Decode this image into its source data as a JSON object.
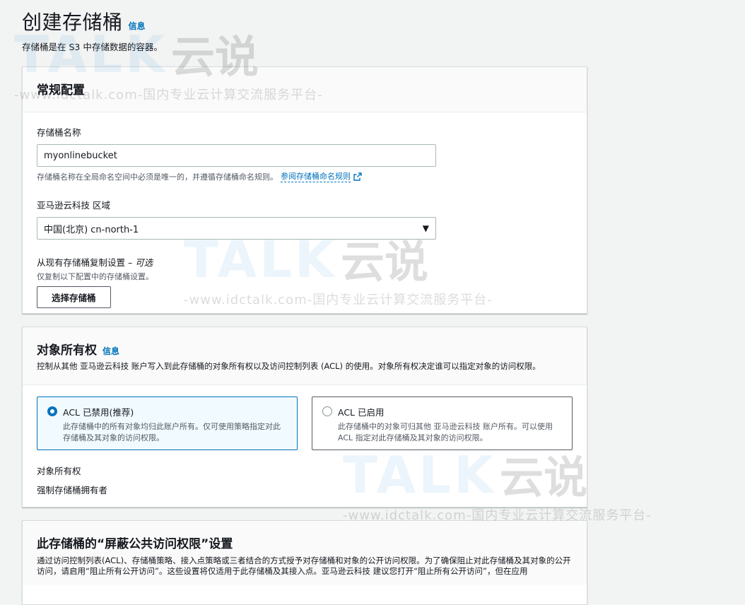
{
  "header": {
    "title": "创建存储桶",
    "info": "信息",
    "description": "存储桶是在 S3 中存储数据的容器。"
  },
  "general": {
    "title": "常规配置",
    "bucket_name_label": "存储桶名称",
    "bucket_name_value": "myonlinebucket",
    "bucket_name_hint": "存储桶名称在全局命名空间中必须是唯一的，并遵循存储桶命名规则。",
    "bucket_name_link": "参阅存储桶命名规则",
    "region_label": "亚马逊云科技 区域",
    "region_value": "中国(北京) cn-north-1",
    "copy_label": "从现有存储桶复制设置 – ",
    "copy_optional": "可选",
    "copy_hint": "仅复制以下配置中的存储桶设置。",
    "choose_bucket_button": "选择存储桶"
  },
  "ownership": {
    "title": "对象所有权",
    "info": "信息",
    "description": "控制从其他 亚马逊云科技 账户写入到此存储桶的对象所有权以及访问控制列表 (ACL) 的使用。对象所有权决定谁可以指定对象的访问权限。",
    "options": [
      {
        "title": "ACL 已禁用(推荐)",
        "description": "此存储桶中的所有对象均归此账户所有。仅可使用策略指定对此存储桶及其对象的访问权限。",
        "selected": true
      },
      {
        "title": "ACL 已启用",
        "description": "此存储桶中的对象可归其他 亚马逊云科技 账户所有。可以使用 ACL 指定对此存储桶及其对象的访问权限。",
        "selected": false
      }
    ],
    "ownership_label": "对象所有权",
    "ownership_value": "强制存储桶拥有者"
  },
  "block_public": {
    "title": "此存储桶的“屏蔽公共访问权限”设置",
    "description": "通过访问控制列表(ACL)、存储桶策略、接入点策略或三者结合的方式授予对存储桶和对象的公开访问权限。为了确保阻止对此存储桶及其对象的公开访问，请启用“阻止所有公开访问”。这些设置将仅适用于此存储桶及其接入点。亚马逊云科技 建议您打开“阻止所有公开访问”，但在应用"
  },
  "watermark": {
    "logo_text": "TALK",
    "cn_text": "云说",
    "url_text": "-www.idctalk.com-国内专业云计算交流服务平台-"
  },
  "colors": {
    "link": "#0073bb",
    "selected_tile_bg": "#f1faff",
    "page_bg": "#f2f3f3"
  }
}
